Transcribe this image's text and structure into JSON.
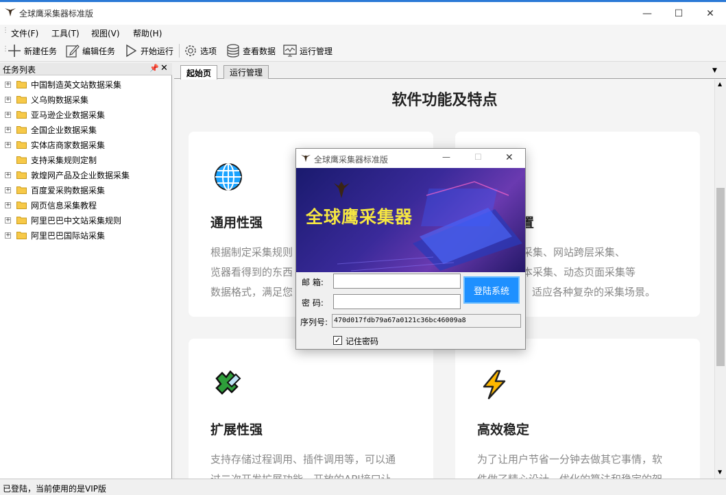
{
  "window": {
    "title": "全球鹰采集器标准版",
    "controls": [
      "minimize",
      "maximize",
      "close"
    ]
  },
  "menu": [
    "文件(F)",
    "工具(T)",
    "视图(V)",
    "帮助(H)"
  ],
  "toolbar": {
    "new_task": "新建任务",
    "edit_task": "编辑任务",
    "start_run": "开始运行",
    "options": "选项",
    "view_data": "查看数据",
    "run_manage": "运行管理"
  },
  "task_panel": {
    "title": "任务列表",
    "items": [
      {
        "label": "中国制造英文站数据采集",
        "expandable": true
      },
      {
        "label": "义乌购数据采集",
        "expandable": true
      },
      {
        "label": "亚马逊企业数据采集",
        "expandable": true
      },
      {
        "label": "全国企业数据采集",
        "expandable": true
      },
      {
        "label": "实体店商家数据采集",
        "expandable": true
      },
      {
        "label": "支持采集规则定制",
        "expandable": false
      },
      {
        "label": "敦煌网产品及企业数据采集",
        "expandable": true
      },
      {
        "label": "百度爱采购数据采集",
        "expandable": true
      },
      {
        "label": "网页信息采集教程",
        "expandable": true
      },
      {
        "label": "阿里巴巴中文站采集规则",
        "expandable": true
      },
      {
        "label": "阿里巴巴国际站采集",
        "expandable": true
      }
    ]
  },
  "tabs": [
    {
      "label": "起始页",
      "active": true
    },
    {
      "label": "运行管理",
      "active": false
    }
  ],
  "content": {
    "heading": "软件功能及特点",
    "cards": [
      {
        "icon": "globe-icon",
        "title": "通用性强",
        "lines": [
          "根据制定采集规则",
          "览器看得到的东西",
          "数据格式，满足您"
        ]
      },
      {
        "icon": "gear-icon",
        "title": "置",
        "lines": [
          "登录采集、网站跨层采集、",
          "、脚本采集、动态页面采集等",
          "适应各种复杂的采集场景。"
        ]
      },
      {
        "icon": "puzzle-icon",
        "title": "扩展性强",
        "lines": [
          "支持存储过程调用、插件调用等，可以通",
          "过二次开发扩展功能，开放的API接口让"
        ]
      },
      {
        "icon": "lightning-icon",
        "title": "高效稳定",
        "lines": [
          "为了让用户节省一分钟去做其它事情，软",
          "件做了精心设计，优化的算法和稳定的架"
        ]
      }
    ]
  },
  "status": "已登陆，当前使用的是VIP版",
  "login_dialog": {
    "title": "全球鹰采集器标准版",
    "banner_text": "全球鹰采集器",
    "email_label": "邮  箱:",
    "email_value": "",
    "password_label": "密  码:",
    "password_value": "",
    "login_button": "登陆系统",
    "serial_label": "序列号:",
    "serial_value": "470d017fdb79a67a0121c36bc46009a8",
    "remember_label": "记住密码",
    "remember_checked": true
  },
  "colors": {
    "accent": "#1e90ff",
    "banner_text": "#f5e642",
    "titlebar_border": "#2b79d6"
  }
}
